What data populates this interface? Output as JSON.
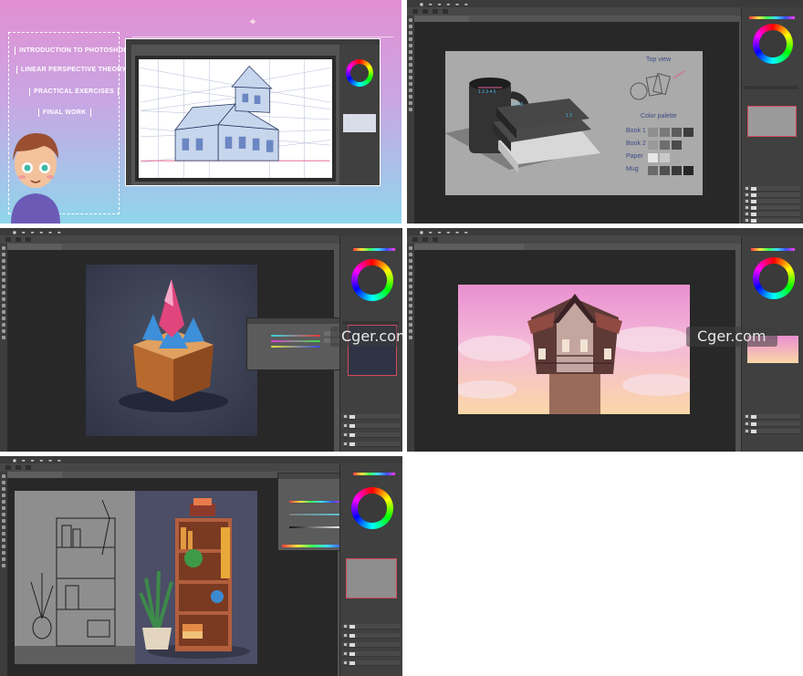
{
  "banner": {
    "items": [
      "INTRODUCTION TO PHOTOSHOP",
      "LINEAR PERSPECTIVE THEORY",
      "PRACTICAL EXERCISES",
      "FINAL WORK"
    ]
  },
  "still_life": {
    "top_view": "Top view",
    "color_palette": "Color palette",
    "rows": [
      {
        "label": "Book 1",
        "swatches": [
          "#8f8f8f",
          "#7a7a7a",
          "#5c5c5c",
          "#3c3c3c"
        ]
      },
      {
        "label": "Book 2",
        "swatches": [
          "#9a9a9a",
          "#6e6e6e",
          "#4b4b4b"
        ]
      },
      {
        "label": "Paper",
        "swatches": [
          "#e6e6e6",
          "#c9c9c9",
          "#a8a8a8"
        ]
      },
      {
        "label": "Mug",
        "swatches": [
          "#6a6a6a",
          "#4f4f4f",
          "#3a3a3a",
          "#262626"
        ]
      }
    ]
  },
  "watermarks": {
    "left": "Cger.com",
    "right": "Cger.com"
  },
  "colors": {
    "banner_top": "#e28fd2",
    "banner_bottom": "#8fd6ec",
    "ps_bg": "#535353",
    "canvas_bg": "#282828",
    "panel_bg": "#404040"
  },
  "icons": {
    "color_wheel": "color-wheel-icon",
    "star": "star-icon",
    "tool": "tool-icon"
  }
}
